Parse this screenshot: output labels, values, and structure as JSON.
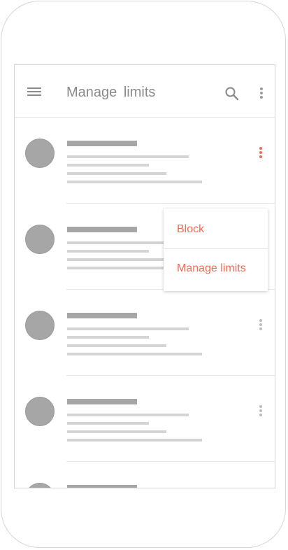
{
  "app_bar": {
    "title": "Manage  limits",
    "icons": [
      "menu-icon",
      "search-icon",
      "more-vert-icon"
    ]
  },
  "popup_menu": {
    "items": [
      {
        "label": "Block"
      },
      {
        "label": "Manage limits"
      }
    ]
  },
  "colors": {
    "accent": "#ef6c55",
    "icon_gray": "#8a8a8a",
    "placeholder_dark": "#a6a6a6",
    "placeholder_light": "#d4d4d4",
    "frame": "#d6d6d6"
  }
}
